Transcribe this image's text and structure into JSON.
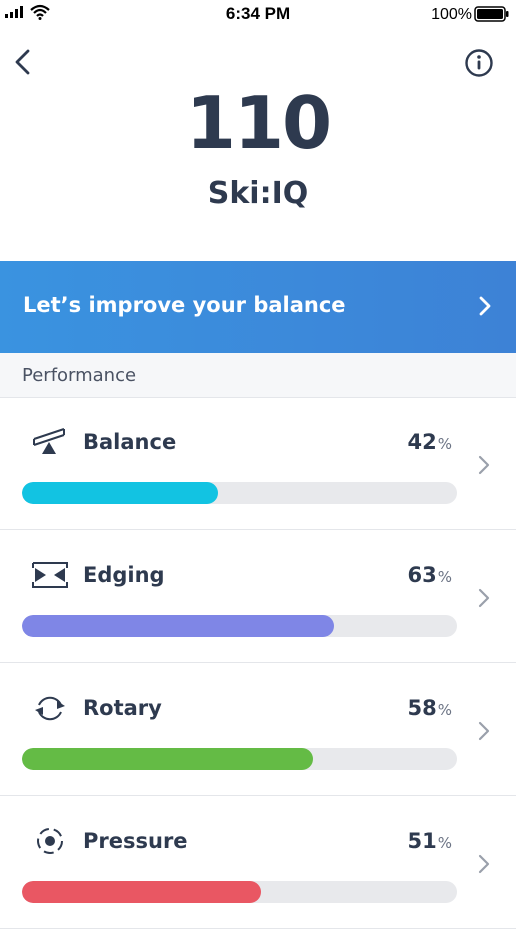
{
  "status_bar": {
    "time": "6:34 PM",
    "battery": "100%"
  },
  "header": {
    "score": "110",
    "score_label": "Ski:IQ"
  },
  "banner": {
    "text": "Let’s improve your balance"
  },
  "section": {
    "title": "Performance"
  },
  "metrics": [
    {
      "name": "Balance",
      "value": "42",
      "unit": "%",
      "bar_fraction": 0.45,
      "color": "#12c3e2",
      "icon": "balance-icon"
    },
    {
      "name": "Edging",
      "value": "63",
      "unit": "%",
      "bar_fraction": 0.717,
      "color": "#7f86e6",
      "icon": "edging-icon"
    },
    {
      "name": "Rotary",
      "value": "58",
      "unit": "%",
      "bar_fraction": 0.67,
      "color": "#64bb45",
      "icon": "rotary-icon"
    },
    {
      "name": "Pressure",
      "value": "51",
      "unit": "%",
      "bar_fraction": 0.55,
      "color": "#e95763",
      "icon": "pressure-icon"
    }
  ],
  "colors": {
    "text": "#2e3a4f",
    "banner": "#3a8bdc",
    "track": "#e8e9ec"
  }
}
